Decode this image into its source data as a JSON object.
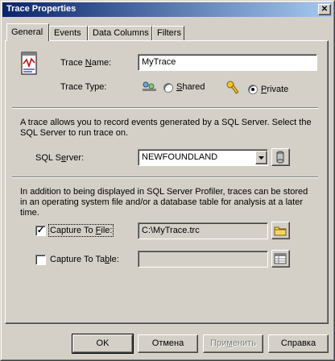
{
  "window": {
    "title": "Trace Properties",
    "close_glyph": "✕"
  },
  "tabs": [
    {
      "label": "General",
      "active": true
    },
    {
      "label": "Events",
      "active": false
    },
    {
      "label": "Data Columns",
      "active": false
    },
    {
      "label": "Filters",
      "active": false
    }
  ],
  "general": {
    "trace_name": {
      "label_pre": "Trace ",
      "label_u": "N",
      "label_post": "ame:",
      "value": "MyTrace"
    },
    "trace_type": {
      "label": "Trace Type:",
      "shared": {
        "label_pre": "",
        "label_u": "S",
        "label_post": "hared",
        "selected": false
      },
      "private": {
        "label_pre": "",
        "label_u": "P",
        "label_post": "rivate",
        "selected": true
      }
    },
    "description1": "A trace allows you to record events generated by a SQL Server. Select the SQL Server to run trace on.",
    "sql_server": {
      "label_pre": "SQL S",
      "label_u": "e",
      "label_post": "rver:",
      "value": "NEWFOUNDLAND"
    },
    "description2": "In addition to being displayed in SQL Server Profiler, traces can be stored in an operating system file and/or a database table for analysis at a later time.",
    "capture_file": {
      "label_pre": "Capture To ",
      "label_u": "F",
      "label_post": "ile:",
      "checked": true,
      "check_glyph": "✓",
      "value": "C:\\MyTrace.trc"
    },
    "capture_table": {
      "label_pre": "Capture To Ta",
      "label_u": "b",
      "label_post": "le:",
      "checked": false,
      "value": ""
    }
  },
  "buttons": {
    "ok": "OK",
    "cancel": "Отмена",
    "apply_pre": "При",
    "apply_u": "м",
    "apply_post": "енить",
    "help": "Справка"
  },
  "icons": {
    "trace": "trace-icon",
    "shared": "shared-icon",
    "private": "key-icon",
    "server": "server-icon",
    "folder": "folder-icon",
    "table": "table-icon",
    "dropdown": "chevron-down-icon"
  }
}
